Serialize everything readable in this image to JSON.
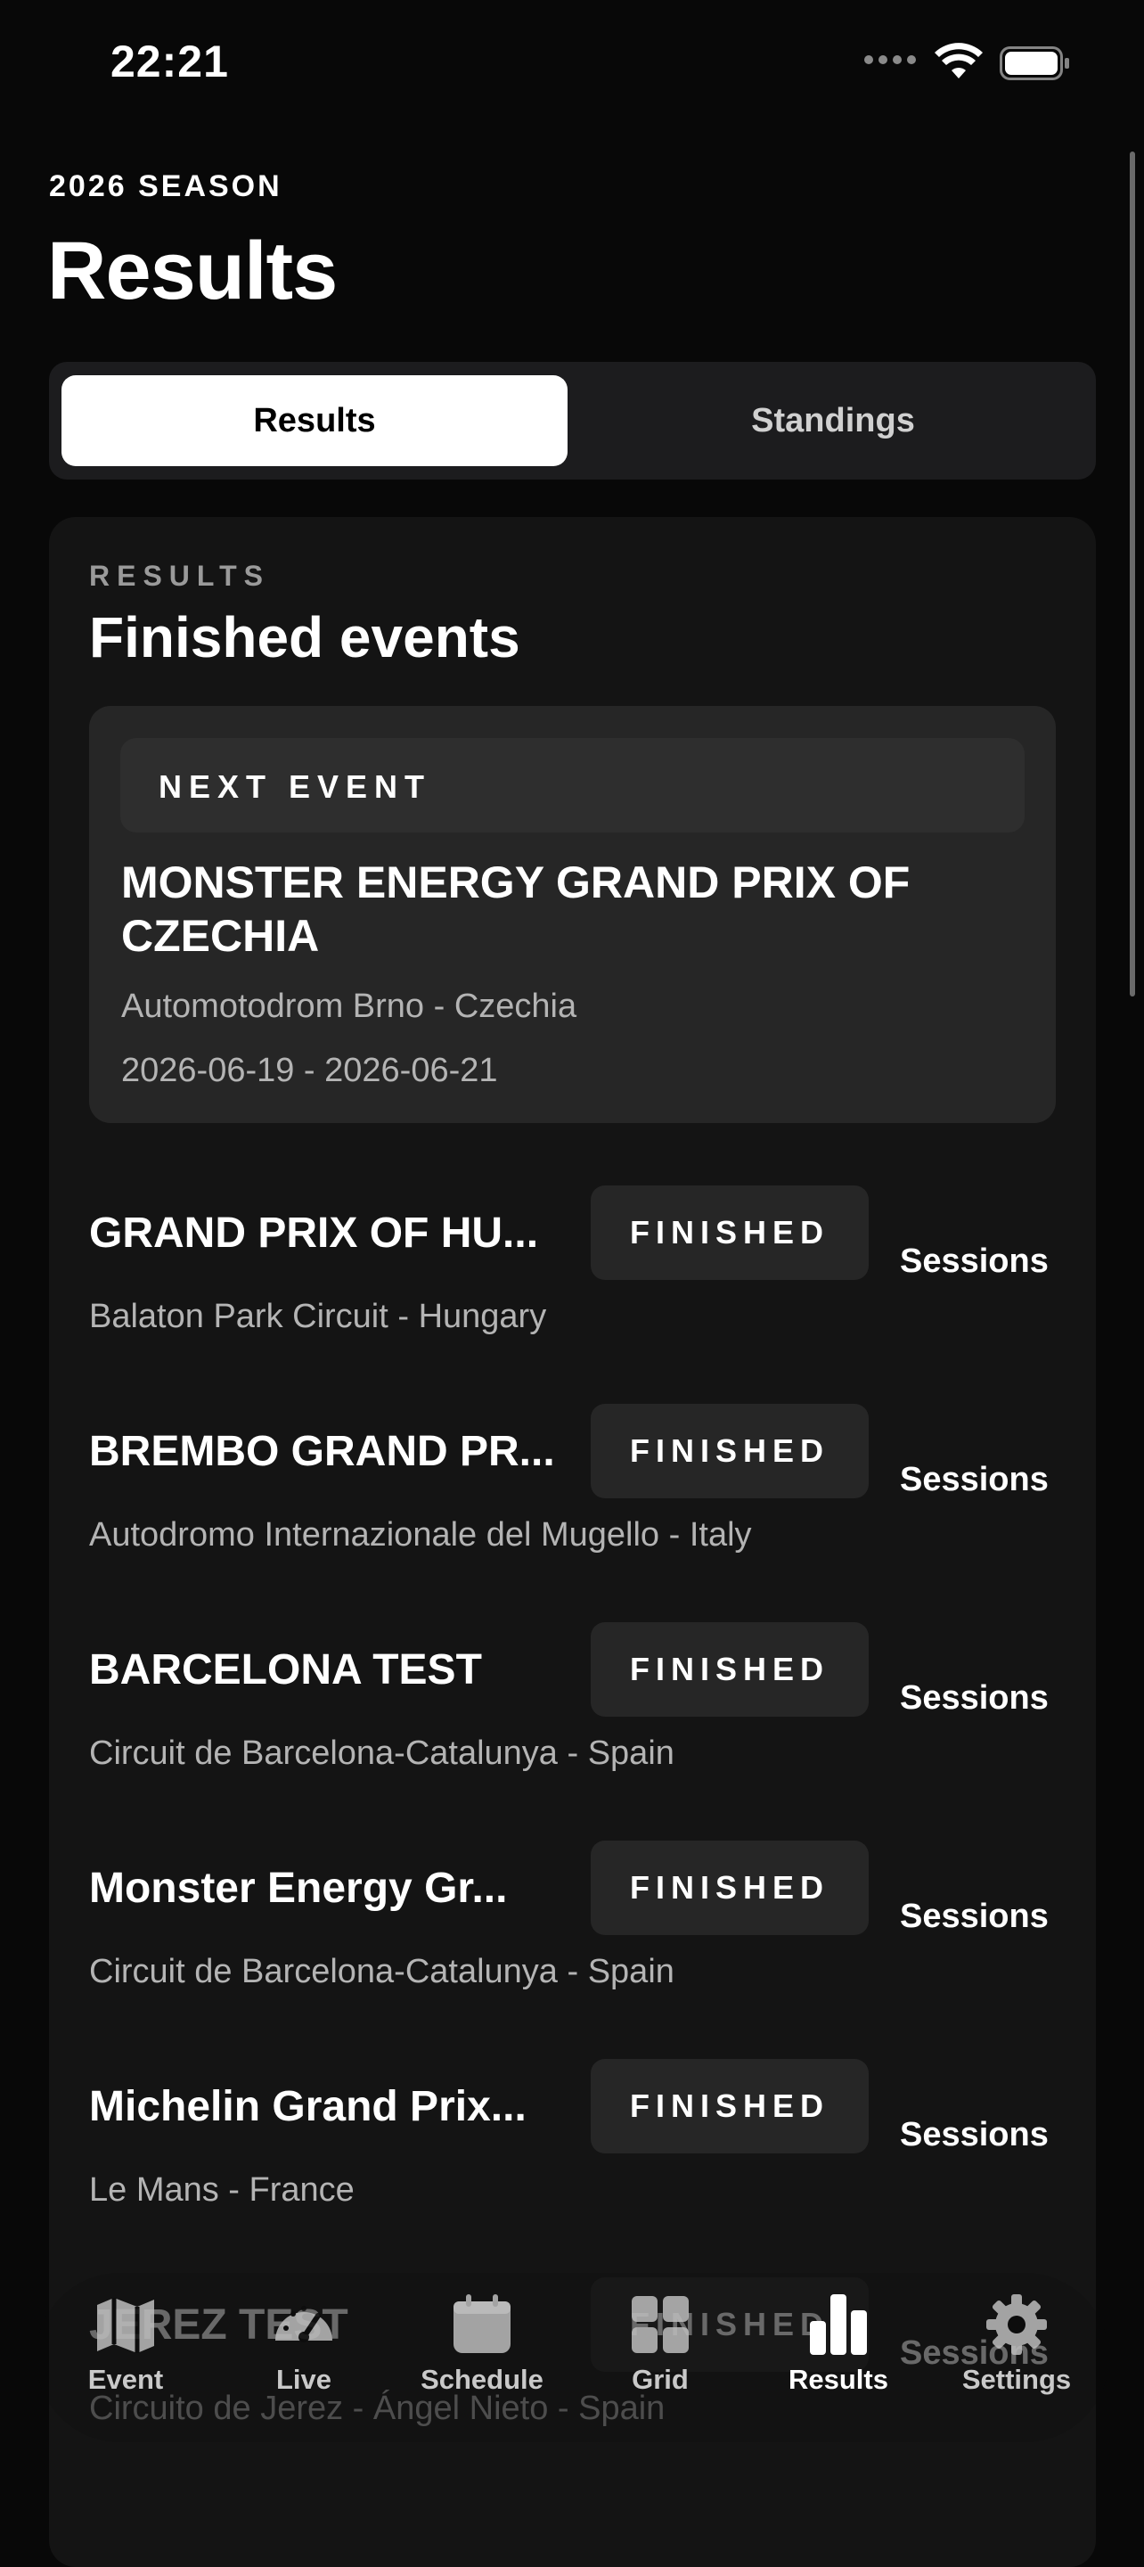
{
  "status_bar": {
    "time": "22:21"
  },
  "header": {
    "season": "2026 SEASON",
    "title": "Results"
  },
  "segments": {
    "active": "Results",
    "inactive": "Standings"
  },
  "card": {
    "eyebrow": "RESULTS",
    "title": "Finished events",
    "next_event": {
      "label": "NEXT EVENT",
      "name": "MONSTER ENERGY GRAND PRIX OF CZECHIA",
      "location": "Automotodrom Brno - Czechia",
      "dates": "2026-06-19 - 2026-06-21"
    },
    "events": [
      {
        "name": "GRAND PRIX OF HU...",
        "location": "Balaton Park Circuit - Hungary",
        "status": "FINISHED",
        "action": "Sessions"
      },
      {
        "name": "BREMBO GRAND PR...",
        "location": "Autodromo Internazionale del Mugello - Italy",
        "status": "FINISHED",
        "action": "Sessions"
      },
      {
        "name": "BARCELONA TEST",
        "location": "Circuit de Barcelona-Catalunya - Spain",
        "status": "FINISHED",
        "action": "Sessions"
      },
      {
        "name": "Monster Energy Gr...",
        "location": "Circuit de Barcelona-Catalunya - Spain",
        "status": "FINISHED",
        "action": "Sessions"
      },
      {
        "name": "Michelin Grand Prix...",
        "location": "Le Mans - France",
        "status": "FINISHED",
        "action": "Sessions"
      },
      {
        "name": "JEREZ TEST",
        "location": "Circuito de Jerez - Ángel Nieto - Spain",
        "status": "FINISHED",
        "action": "Sessions"
      }
    ]
  },
  "tabbar": {
    "items": [
      {
        "label": "Event",
        "icon": "map-icon"
      },
      {
        "label": "Live",
        "icon": "gauge-icon"
      },
      {
        "label": "Schedule",
        "icon": "calendar-icon"
      },
      {
        "label": "Grid",
        "icon": "grid-icon"
      },
      {
        "label": "Results",
        "icon": "bar-chart-icon"
      },
      {
        "label": "Settings",
        "icon": "gear-icon"
      }
    ],
    "active": "Results"
  }
}
